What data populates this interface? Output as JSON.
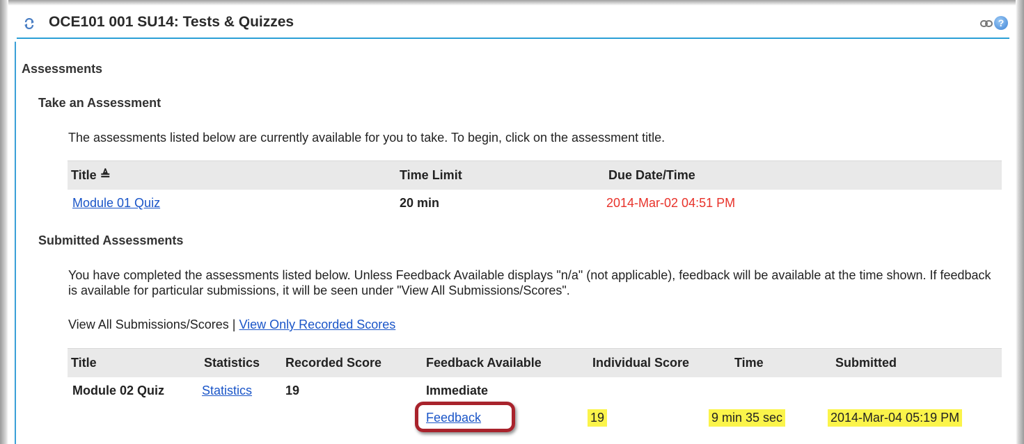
{
  "header": {
    "title": "OCE101 001 SU14: Tests & Quizzes",
    "icons": [
      "refresh-icon",
      "link-icon",
      "help-icon"
    ]
  },
  "assessments_heading": "Assessments",
  "take": {
    "heading": "Take an Assessment",
    "intro": "The assessments listed below are currently available for you to take. To begin, click on the assessment title.",
    "columns": [
      "Title",
      "Time Limit",
      "Due Date/Time"
    ],
    "sort_glyph": "≜",
    "rows": [
      {
        "title": "Module 01 Quiz ",
        "time_limit": "20 min",
        "due": "2014-Mar-02 04:51 PM"
      }
    ]
  },
  "submitted": {
    "heading": "Submitted Assessments",
    "intro": "You have completed the assessments listed below. Unless Feedback Available displays \"n/a\" (not applicable), feedback will be available at the time shown. If feedback is available for particular submissions, it will be seen under \"View All Submissions/Scores\".",
    "view_all": "View All Submissions/Scores",
    "separator": "|",
    "view_recorded": "View Only Recorded Scores",
    "columns": [
      "Title",
      "Statistics",
      "Recorded Score",
      "Feedback Available",
      "Individual Score",
      "Time",
      "Submitted"
    ],
    "rows": [
      {
        "title": "Module 02 Quiz",
        "statistics": "Statistics",
        "recorded_score": "19",
        "feedback_available": "Immediate",
        "feedback_link": "Feedback",
        "individual_score": "19",
        "time": "9 min 35 sec",
        "submitted": "2014-Mar-04 05:19 PM"
      }
    ]
  },
  "colors": {
    "accent_rule": "#2a9fd6",
    "link": "#1a55c8",
    "due_date": "#e8322a",
    "highlight": "#fbf44a",
    "callout": "#a8232c"
  }
}
